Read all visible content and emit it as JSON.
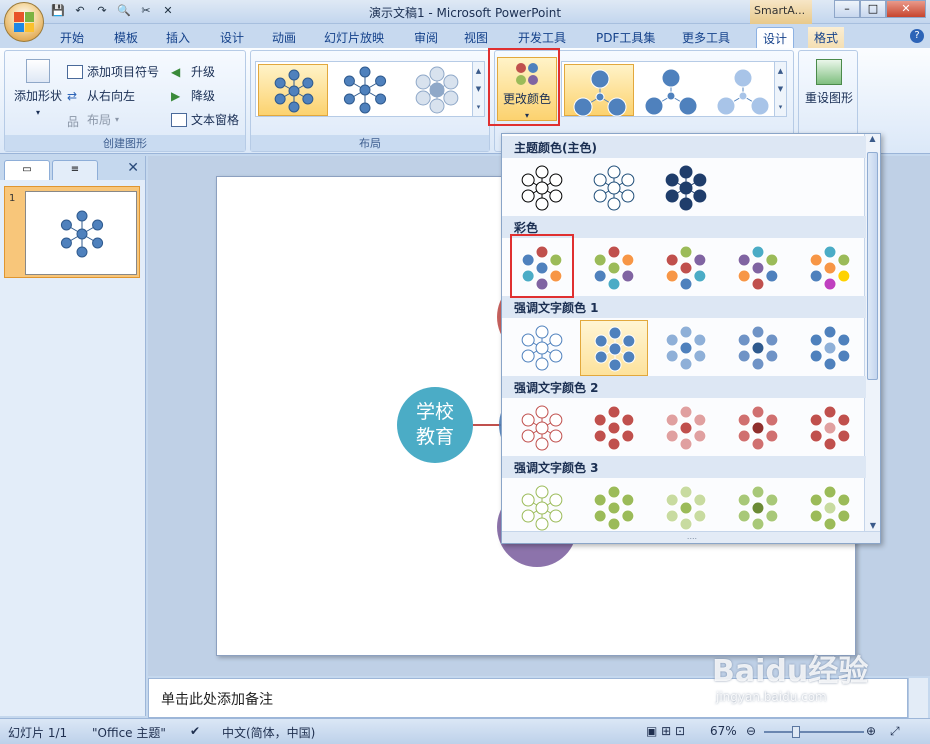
{
  "window": {
    "title": "演示文稿1 - Microsoft PowerPoint",
    "contextual_tab": "SmartA...",
    "min": "–",
    "max": "□",
    "close": "✕"
  },
  "qat": [
    "💾",
    "↶",
    "↷",
    "🔍",
    "✂",
    "✕"
  ],
  "tabs": [
    "开始",
    "模板",
    "插入",
    "设计",
    "动画",
    "幻灯片放映",
    "审阅",
    "视图",
    "开发工具",
    "PDF工具集",
    "更多工具",
    "设计",
    "格式"
  ],
  "active_tab_index": 11,
  "help": "?",
  "ribbon": {
    "create_graphic": {
      "label": "创建图形",
      "add_shape": "添加形状",
      "add_bullet": "添加项目符号",
      "right_to_left": "从右向左",
      "layout": "布局",
      "promote": "升级",
      "demote": "降级",
      "text_pane": "文本窗格"
    },
    "layouts": {
      "label": "布局"
    },
    "styles": {
      "change_colors": "更改颜色",
      "reset_graphic": "重设图形"
    }
  },
  "dropdown": {
    "sections": [
      {
        "title": "主题颜色(主色)",
        "palettes": [
          [
            "#000000",
            "#000000"
          ],
          [
            "#1f4e79",
            "#1f4e79"
          ],
          [
            "#1f3d6b",
            "#1f3d6b"
          ]
        ]
      },
      {
        "title": "彩色",
        "palettes": [
          [
            "#4f81bd",
            "#c0504d",
            "#9bbb59",
            "#f79646",
            "#8064a2",
            "#4bacc6"
          ],
          [
            "#9bbb59",
            "#c0504d",
            "#f79646",
            "#8064a2",
            "#4bacc6",
            "#4f81bd"
          ],
          [
            "#c0504d",
            "#9bbb59",
            "#8064a2",
            "#4bacc6",
            "#4f81bd",
            "#f79646"
          ],
          [
            "#8064a2",
            "#4bacc6",
            "#9bbb59",
            "#4f81bd",
            "#c0504d",
            "#f79646"
          ],
          [
            "#f79646",
            "#4bacc6",
            "#9bbb59",
            "#ffd200",
            "#c040c0",
            "#4f81bd"
          ]
        ]
      },
      {
        "title": "强调文字颜色 1",
        "palettes": [
          [
            "#ffffff",
            "#4f81bd"
          ],
          [
            "#4f81bd",
            "#4f81bd"
          ],
          [
            "#4f81bd",
            "#8fb0d8"
          ],
          [
            "#2f5a8e",
            "#6f93c6"
          ],
          [
            "#8fb0d8",
            "#4f81bd"
          ]
        ]
      },
      {
        "title": "强调文字颜色 2",
        "palettes": [
          [
            "#ffffff",
            "#c0504d"
          ],
          [
            "#c0504d",
            "#c0504d"
          ],
          [
            "#c0504d",
            "#e0a0a0"
          ],
          [
            "#8f2f2d",
            "#d07070"
          ],
          [
            "#e0a0a0",
            "#c0504d"
          ]
        ]
      },
      {
        "title": "强调文字颜色 3",
        "palettes": [
          [
            "#ffffff",
            "#9bbb59"
          ],
          [
            "#9bbb59",
            "#9bbb59"
          ],
          [
            "#9bbb59",
            "#c8dba0"
          ],
          [
            "#6b8a35",
            "#a8c878"
          ],
          [
            "#c8dba0",
            "#9bbb59"
          ]
        ]
      }
    ],
    "grip": "....",
    "selected_index": 1
  },
  "left_pane": {
    "slide_number": "1",
    "close": "✕"
  },
  "slide": {
    "center_text_line1": "学校",
    "center_text_line2": "教育"
  },
  "notes": "单击此处添加备注",
  "status": {
    "slide": "幻灯片 1/1",
    "theme": "\"Office 主题\"",
    "language": "中文(简体，中国)",
    "zoom": "67%"
  },
  "watermark": {
    "main": "Baidu经验",
    "sub": "jingyan.baidu.com"
  }
}
